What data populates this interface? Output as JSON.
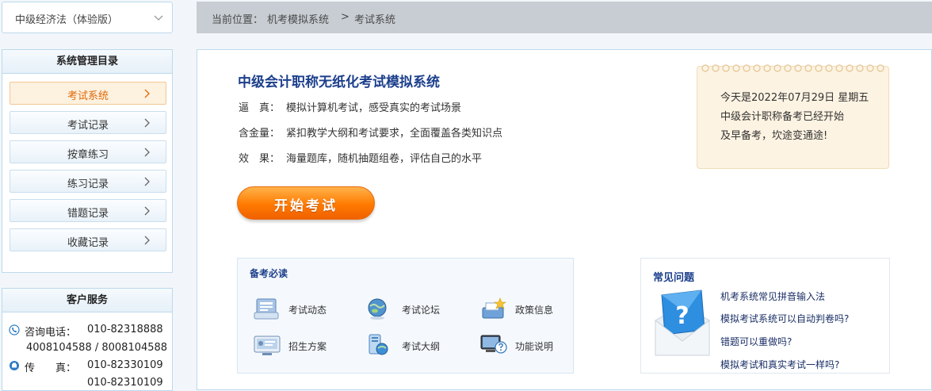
{
  "course_select": {
    "value": "中级经济法（体验版）"
  },
  "menu": {
    "title": "系统管理目录",
    "items": [
      {
        "label": "考试系统",
        "active": true
      },
      {
        "label": "考试记录"
      },
      {
        "label": "按章练习"
      },
      {
        "label": "练习记录"
      },
      {
        "label": "错题记录"
      },
      {
        "label": "收藏记录"
      }
    ]
  },
  "service": {
    "title": "客户服务",
    "phone_label": "咨询电话：",
    "phone_1": "010-82318888",
    "phone_2": "4008104588 / 8008104588",
    "fax_label": "传　　真：",
    "fax_1": "010-82330109",
    "fax_2": "010-82310109"
  },
  "breadcrumb": {
    "prefix": "当前位置：",
    "level1": "机考模拟系统",
    "sep": ">",
    "level2": "考试系统"
  },
  "main": {
    "title": "中级会计职称无纸化考试模拟系统",
    "features": [
      {
        "key": "逼　真：",
        "text": "模拟计算机考试，感受真实的考试场景"
      },
      {
        "key": "含金量：",
        "text": "紧扣教学大纲和考试要求，全面覆盖各类知识点"
      },
      {
        "key": "效　果：",
        "text": "海量题库，随机抽题组卷，评估自己的水平"
      }
    ],
    "start_label": "开始考试"
  },
  "notice": {
    "lines": [
      "今天是2022年07月29日 星期五",
      "中级会计职称备考已经开始",
      "及早备考，坎途变通途!"
    ]
  },
  "must_read": {
    "title": "备考必读",
    "items": [
      {
        "label": "考试动态",
        "icon": "news-icon"
      },
      {
        "label": "考试论坛",
        "icon": "globe-icon"
      },
      {
        "label": "政策信息",
        "icon": "policy-icon"
      },
      {
        "label": "招生方案",
        "icon": "monitor-icon"
      },
      {
        "label": "考试大纲",
        "icon": "outline-icon"
      },
      {
        "label": "功能说明",
        "icon": "help-icon"
      }
    ]
  },
  "faq": {
    "title": "常见问题",
    "questions": [
      "机考系统常见拼音输入法",
      "模拟考试系统可以自动判卷吗?",
      "错题可以重做吗?",
      "模拟考试和真实考试一样吗?"
    ]
  },
  "colors": {
    "accent_orange": "#ff7a00",
    "title_blue": "#1c3f8c",
    "panel_border": "#bcd9ec"
  }
}
